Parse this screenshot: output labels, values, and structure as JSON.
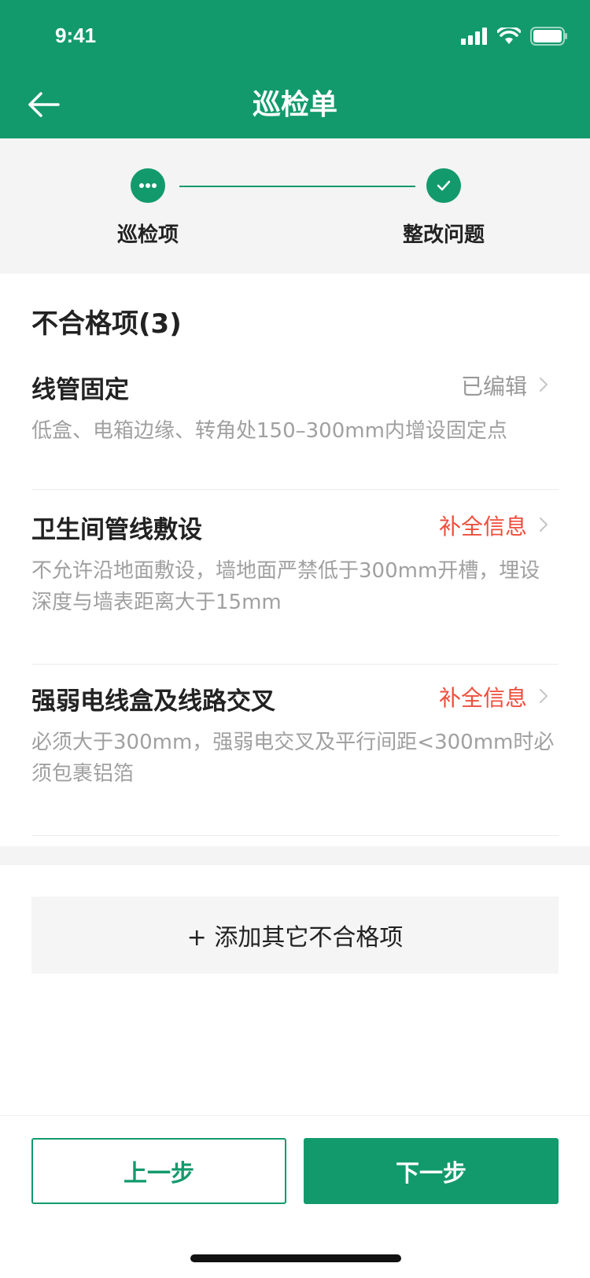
{
  "status_bar": {
    "time": "9:41",
    "icons": [
      "signal-icon",
      "wifi-icon",
      "battery-icon"
    ]
  },
  "header": {
    "title": "巡检单",
    "back_icon": "back-arrow-icon"
  },
  "stepper": {
    "steps": [
      {
        "label": "巡检项",
        "state": "in-progress"
      },
      {
        "label": "整改问题",
        "state": "done"
      }
    ]
  },
  "section": {
    "title": "不合格项(3)",
    "items": [
      {
        "name": "线管固定",
        "status": "已编辑",
        "desc": "低盒、电箱边缘、转角处150–300mm内增设固定点"
      },
      {
        "name": "卫生间管线敷设",
        "status": "补全信息",
        "desc": "不允许沿地面敷设，墙地面严禁低于300mm开槽，埋设深度与墙表距离大于15mm"
      },
      {
        "name": "强弱电线盒及线路交叉",
        "status": "补全信息",
        "desc": "必须大于300mm，强弱电交叉及平行间距<300mm时必须包裹铝箔"
      }
    ]
  },
  "add_button": {
    "label": "+ 添加其它不合格项"
  },
  "footer": {
    "prev_label": "上一步",
    "next_label": "下一步"
  },
  "colors": {
    "brand": "#139a6c",
    "warn": "#ef4d3b",
    "muted": "#a0a0a0"
  }
}
